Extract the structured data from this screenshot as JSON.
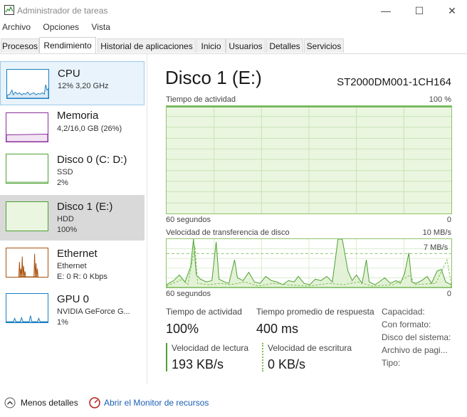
{
  "window": {
    "title": "Administrador de tareas",
    "minimize_glyph": "—",
    "maximize_glyph": "☐",
    "close_glyph": "✕"
  },
  "menu": [
    "Archivo",
    "Opciones",
    "Vista"
  ],
  "tabs": [
    {
      "label": "Procesos"
    },
    {
      "label": "Rendimiento",
      "active": true
    },
    {
      "label": "Historial de aplicaciones"
    },
    {
      "label": "Inicio"
    },
    {
      "label": "Usuarios"
    },
    {
      "label": "Detalles"
    },
    {
      "label": "Servicios"
    }
  ],
  "sidebar": {
    "items": [
      {
        "title": "CPU",
        "line1": "12%  3,20 GHz",
        "line2": ""
      },
      {
        "title": "Memoria",
        "line1": "4,2/16,0 GB (26%)",
        "line2": ""
      },
      {
        "title": "Disco 0 (C: D:)",
        "line1": "SSD",
        "line2": "2%"
      },
      {
        "title": "Disco 1 (E:)",
        "line1": "HDD",
        "line2": "100%"
      },
      {
        "title": "Ethernet",
        "line1": "Ethernet",
        "line2": "E: 0 R: 0 Kbps"
      },
      {
        "title": "GPU 0",
        "line1": "NVIDIA GeForce G...",
        "line2": "1%"
      }
    ]
  },
  "main": {
    "title": "Disco 1 (E:)",
    "model": "ST2000DM001-1CH164",
    "chart1": {
      "label": "Tiempo de actividad",
      "max": "100 %",
      "time_label": "60 segundos",
      "min": "0"
    },
    "chart2": {
      "label": "Velocidad de transferencia de disco",
      "max": "10 MB/s",
      "inner_label": "7 MB/s",
      "time_label": "60 segundos",
      "min": "0"
    },
    "stats": {
      "active_label": "Tiempo de actividad",
      "active_value": "100%",
      "response_label": "Tiempo promedio de respuesta",
      "response_value": "400 ms",
      "read_label": "Velocidad de lectura",
      "read_value": "193 KB/s",
      "write_label": "Velocidad de escritura",
      "write_value": "0 KB/s"
    },
    "properties": [
      "Capacidad:",
      "Con formato:",
      "Disco del sistema:",
      "Archivo de pagi...",
      "Tipo:"
    ]
  },
  "footer": {
    "fewer_details": "Menos detalles",
    "resource_monitor": "Abrir el Monitor de recursos"
  },
  "colors": {
    "cpu": "#1a7ec0",
    "memory": "#8a2f9c",
    "disk": "#4da033",
    "ethernet": "#a8520e",
    "gpu": "#1a7ec0",
    "chart_fill": "#f6fbf1",
    "link": "#1a5fb4"
  }
}
